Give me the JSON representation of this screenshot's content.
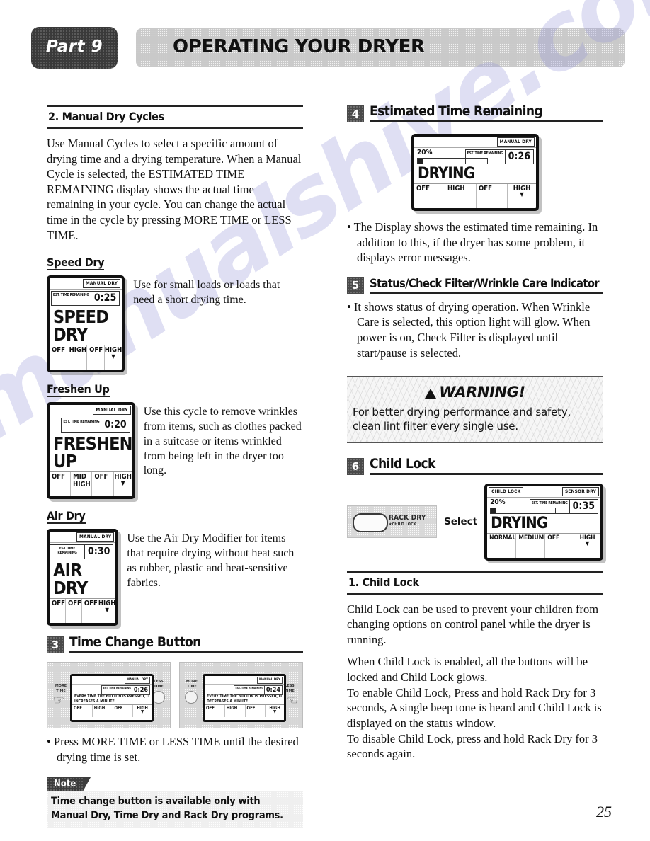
{
  "header": {
    "part_tab": "Part 9",
    "title": "OPERATING YOUR DRYER"
  },
  "page_number": "25",
  "watermark": "manualshive.com",
  "left_column": {
    "section2": {
      "title": "2. Manual Dry Cycles",
      "body": "Use Manual Cycles to select a specific amount of drying time and a drying temperature. When a Manual Cycle is selected, the ESTIMATED TIME REMAINING display shows the actual time remaining in your cycle. You can change the actual time in the cycle by pressing MORE TIME or LESS TIME."
    },
    "speed_dry": {
      "heading": "Speed Dry",
      "caption": "Use for small loads or loads that need a short drying time.",
      "display": {
        "mode_badge": "MANUAL DRY",
        "time_label": "EST. TIME REMAINING",
        "time_value": "0:25",
        "status": "SPEED DRY",
        "options": [
          "OFF",
          "HIGH",
          "OFF",
          "HIGH"
        ]
      }
    },
    "freshen_up": {
      "heading": "Freshen Up",
      "caption": "Use this cycle to remove wrinkles from items, such as clothes packed in a suitcase or items wrinkled from being left in the dryer too long.",
      "display": {
        "mode_badge": "MANUAL DRY",
        "time_label": "EST. TIME REMAINING",
        "time_value": "0:20",
        "status": "FRESHEN UP",
        "options": [
          "OFF",
          "MID HIGH",
          "OFF",
          "HIGH"
        ]
      }
    },
    "air_dry": {
      "heading": "Air Dry",
      "caption": "Use the Air Dry Modifier for items that require drying without heat such as rubber, plastic and heat-sensitive fabrics.",
      "display": {
        "mode_badge": "MANUAL DRY",
        "time_label": "EST. TIME REMAINING",
        "time_value": "0:30",
        "status": "AIR DRY",
        "options": [
          "OFF",
          "OFF",
          "OFF",
          "HIGH"
        ]
      }
    },
    "section3": {
      "number": "3",
      "title": "Time Change Button",
      "panel_more": {
        "left_button_label": "MORE TIME",
        "right_button_label": "LESS TIME",
        "mode_badge": "MANUAL DRY",
        "time_label": "EST. TIME REMAINING",
        "time_value": "0:26",
        "message": "EVERY TIME THE BUTTON IS PRESSED, IT INCREASES A MINUTE.",
        "options": [
          "OFF",
          "HIGH",
          "OFF",
          "HIGH"
        ]
      },
      "panel_less": {
        "left_button_label": "MORE TIME",
        "right_button_label": "LESS TIME",
        "mode_badge": "MANUAL DRY",
        "time_label": "EST. TIME REMAINING",
        "time_value": "0:24",
        "message": "EVERY TIME THE BUTTON IS PRESSED, IT DECREASES A MINUTE.",
        "options": [
          "OFF",
          "HIGH",
          "OFF",
          "HIGH"
        ]
      },
      "bullet": "• Press MORE TIME or LESS TIME until the desired drying time is set."
    },
    "note": {
      "tag": "Note",
      "text": "Time change button is available only with Manual Dry, Time Dry and Rack Dry programs."
    }
  },
  "right_column": {
    "section4": {
      "number": "4",
      "title": "Estimated Time Remaining",
      "display": {
        "mode_badge": "MANUAL DRY",
        "percent": "20%",
        "progress": 8,
        "time_label": "EST. TIME REMAINING",
        "time_value": "0:26",
        "status": "DRYING",
        "options": [
          "OFF",
          "HIGH",
          "OFF",
          "HIGH"
        ]
      },
      "bullet": "• The Display shows the estimated time remaining. In addition to this, if the dryer has some problem, it displays error messages."
    },
    "section5": {
      "number": "5",
      "title": "Status/Check Filter/Wrinkle Care Indicator",
      "bullet": "• It shows status of drying operation. When Wrinkle Care is selected, this option light will glow. When power is on, Check Filter is displayed until start/pause is selected."
    },
    "warning": {
      "title": "WARNING!",
      "text": "For better drying performance and safety, clean lint filter every single use."
    },
    "section6": {
      "number": "6",
      "title": "Child Lock",
      "button": {
        "label": "RACK DRY",
        "sublabel": "★CHILD LOCK"
      },
      "select_label": "Select",
      "display": {
        "badge_left": "CHILD LOCK",
        "badge_right": "SENSOR DRY",
        "percent": "20%",
        "progress": 8,
        "time_label": "EST. TIME REMAINING",
        "time_value": "0:35",
        "status": "DRYING",
        "options": [
          "NORMAL",
          "MEDIUM",
          "OFF",
          "HIGH"
        ]
      },
      "sub_title": "1. Child Lock",
      "para1": "Child Lock can be used to prevent your children from changing options on control panel while the dryer is running.",
      "para2": "When Child Lock is enabled, all the buttons will be locked and Child Lock glows.",
      "para3": "To enable Child Lock, Press and hold Rack Dry for 3 seconds, A single beep tone is heard and Child Lock  is displayed on the status window.",
      "para4": "To disable Child Lock, press and hold Rack Dry for 3 seconds again."
    }
  }
}
